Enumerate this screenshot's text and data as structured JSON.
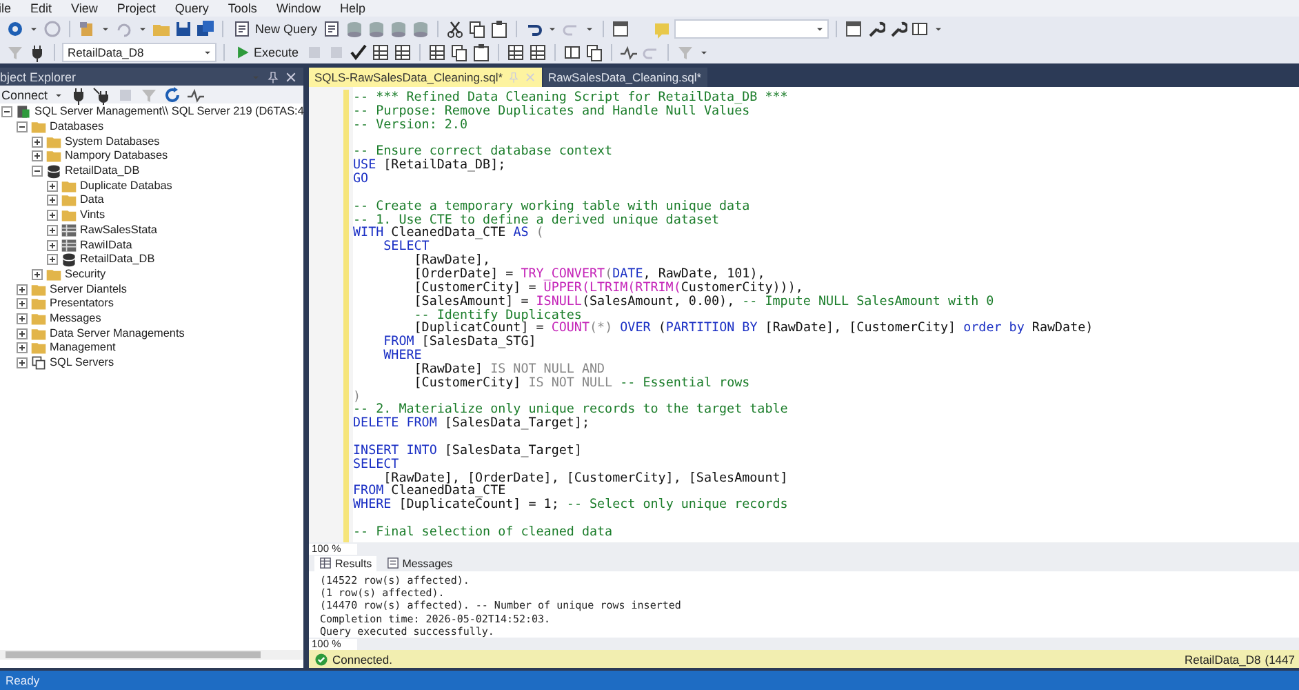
{
  "menu": [
    "ile",
    "Edit",
    "View",
    "Project",
    "Query",
    "Tools",
    "Window",
    "Help"
  ],
  "toolbar": {
    "new_query": "New Query",
    "database": "RetailData_D8",
    "execute": "Execute"
  },
  "explorer": {
    "title": "bject Explorer",
    "connect": "Connect",
    "tree": [
      {
        "label": "SQL Server Management\\\\ SQL Server 219 (D6TAS:4",
        "kind": "server",
        "expanded": true,
        "children": [
          {
            "label": "Databases",
            "kind": "folder",
            "expanded": true,
            "children": [
              {
                "label": "System Databases",
                "kind": "folder",
                "expanded": false
              },
              {
                "label": "Nampory Databases",
                "kind": "folder",
                "expanded": false
              },
              {
                "label": "RetailData_DB",
                "kind": "database",
                "expanded": true,
                "children": [
                  {
                    "label": "Duplicate Databas",
                    "kind": "folder",
                    "expanded": false
                  },
                  {
                    "label": "Data",
                    "kind": "folder",
                    "expanded": false
                  },
                  {
                    "label": "Vints",
                    "kind": "folder",
                    "expanded": false
                  },
                  {
                    "label": "RawSalesStata",
                    "kind": "table",
                    "expanded": false
                  },
                  {
                    "label": "RawiIData",
                    "kind": "table",
                    "expanded": false
                  },
                  {
                    "label": "RetailData_DB",
                    "kind": "database",
                    "expanded": false
                  }
                ]
              },
              {
                "label": "Security",
                "kind": "folder",
                "expanded": false
              }
            ]
          },
          {
            "label": "Server Diantels",
            "kind": "folder",
            "expanded": false
          },
          {
            "label": "Presentators",
            "kind": "folder",
            "expanded": false
          },
          {
            "label": "Messages",
            "kind": "folder",
            "expanded": false
          },
          {
            "label": "Data Server Managements",
            "kind": "folder",
            "expanded": false
          },
          {
            "label": "Management",
            "kind": "folder",
            "expanded": false
          },
          {
            "label": "SQL Servers",
            "kind": "servers",
            "expanded": false
          }
        ]
      }
    ]
  },
  "editor": {
    "tabs": [
      {
        "label": "SQLS-RawSalesData_Cleaning.sql*",
        "selected": true
      },
      {
        "label": "RawSalesData_Cleaning.sql*",
        "selected": false
      }
    ],
    "lines": [
      {
        "kind": "code",
        "tokens": [
          {
            "kind": "comment",
            "text": "-- *** Refined Data Cleaning Script for RetailData_DB ***"
          }
        ]
      },
      {
        "kind": "code",
        "tokens": [
          {
            "kind": "comment",
            "text": "-- Purpose: Remove Duplicates and Handle Null Values"
          }
        ]
      },
      {
        "kind": "code",
        "tokens": [
          {
            "kind": "comment",
            "text": "-- Version: 2.0"
          }
        ]
      },
      {
        "kind": "blank"
      },
      {
        "kind": "code",
        "tokens": [
          {
            "kind": "comment",
            "text": "-- Ensure correct database context"
          }
        ]
      },
      {
        "kind": "code",
        "tokens": [
          {
            "kind": "keyword",
            "text": "USE"
          },
          {
            "kind": "text",
            "text": " [RetailData_DB];"
          }
        ]
      },
      {
        "kind": "code",
        "tokens": [
          {
            "kind": "keyword",
            "text": "GO"
          }
        ]
      },
      {
        "kind": "blank"
      },
      {
        "kind": "code",
        "tokens": [
          {
            "kind": "comment",
            "text": "-- Create a temporary working table with unique data"
          }
        ]
      },
      {
        "kind": "code",
        "tokens": [
          {
            "kind": "comment",
            "text": "-- 1. Use CTE to define a derived unique dataset"
          }
        ]
      },
      {
        "kind": "code",
        "tokens": [
          {
            "kind": "keyword",
            "text": "WITH"
          },
          {
            "kind": "text",
            "text": " CleanedData_CTE "
          },
          {
            "kind": "keyword",
            "text": "AS"
          },
          {
            "kind": "gray",
            "text": " ("
          }
        ]
      },
      {
        "kind": "code",
        "tokens": [
          {
            "kind": "keyword",
            "text": "    SELECT"
          }
        ]
      },
      {
        "kind": "code",
        "tokens": [
          {
            "kind": "text",
            "text": "        [RawDate],"
          }
        ]
      },
      {
        "kind": "code",
        "tokens": [
          {
            "kind": "text",
            "text": "        [OrderDate] = "
          },
          {
            "kind": "function",
            "text": "TRY_CONVERT"
          },
          {
            "kind": "gray",
            "text": "("
          },
          {
            "kind": "keyword",
            "text": "DATE"
          },
          {
            "kind": "text",
            "text": ", RawDate, 101),"
          }
        ]
      },
      {
        "kind": "code",
        "tokens": [
          {
            "kind": "text",
            "text": "        [CustomerCity] = "
          },
          {
            "kind": "function",
            "text": "UPPER(LTRIM(RTRIM("
          },
          {
            "kind": "text",
            "text": "CustomerCity))),"
          }
        ]
      },
      {
        "kind": "code",
        "tokens": [
          {
            "kind": "text",
            "text": "        [SalesAmount] = "
          },
          {
            "kind": "function",
            "text": "ISNULL"
          },
          {
            "kind": "text",
            "text": "(SalesAmount, 0.00), "
          },
          {
            "kind": "comment",
            "text": "-- Impute NULL SalesAmount with 0"
          }
        ]
      },
      {
        "kind": "code",
        "tokens": [
          {
            "kind": "comment",
            "text": "        -- Identify Duplicates"
          }
        ]
      },
      {
        "kind": "code",
        "tokens": [
          {
            "kind": "text",
            "text": "        [DuplicatCount] = "
          },
          {
            "kind": "function",
            "text": "COUNT"
          },
          {
            "kind": "gray",
            "text": "(*) "
          },
          {
            "kind": "keyword",
            "text": "OVER"
          },
          {
            "kind": "text",
            "text": " ("
          },
          {
            "kind": "keyword",
            "text": "PARTITION BY"
          },
          {
            "kind": "text",
            "text": " [RawDate], [CustomerCity] "
          },
          {
            "kind": "keyword",
            "text": "order by"
          },
          {
            "kind": "text",
            "text": " RawDate)"
          }
        ]
      },
      {
        "kind": "code",
        "tokens": [
          {
            "kind": "keyword",
            "text": "    FROM"
          },
          {
            "kind": "text",
            "text": " [SalesData_STG]"
          }
        ]
      },
      {
        "kind": "code",
        "tokens": [
          {
            "kind": "keyword",
            "text": "    WHERE"
          }
        ]
      },
      {
        "kind": "code",
        "tokens": [
          {
            "kind": "text",
            "text": "        [RawDate] "
          },
          {
            "kind": "gray",
            "text": "IS NOT NULL AND"
          }
        ]
      },
      {
        "kind": "code",
        "tokens": [
          {
            "kind": "text",
            "text": "        [CustomerCity] "
          },
          {
            "kind": "gray",
            "text": "IS NOT NULL"
          },
          {
            "kind": "comment",
            "text": " -- Essential rows"
          }
        ]
      },
      {
        "kind": "code",
        "tokens": [
          {
            "kind": "gray",
            "text": ")"
          }
        ]
      },
      {
        "kind": "code",
        "tokens": [
          {
            "kind": "comment",
            "text": "-- 2. Materialize only unique records to the target table"
          }
        ]
      },
      {
        "kind": "code",
        "tokens": [
          {
            "kind": "keyword",
            "text": "DELETE FROM"
          },
          {
            "kind": "text",
            "text": " [SalesData_Target];"
          }
        ]
      },
      {
        "kind": "blank"
      },
      {
        "kind": "code",
        "tokens": [
          {
            "kind": "keyword",
            "text": "INSERT INTO"
          },
          {
            "kind": "text",
            "text": " [SalesData_Target]"
          }
        ]
      },
      {
        "kind": "code",
        "tokens": [
          {
            "kind": "keyword",
            "text": "SELECT"
          }
        ]
      },
      {
        "kind": "code",
        "tokens": [
          {
            "kind": "text",
            "text": "    [RawDate], [OrderDate], [CustomerCity], [SalesAmount]"
          }
        ]
      },
      {
        "kind": "code",
        "tokens": [
          {
            "kind": "keyword",
            "text": "FROM"
          },
          {
            "kind": "text",
            "text": " CleanedData_CTE"
          }
        ]
      },
      {
        "kind": "code",
        "tokens": [
          {
            "kind": "keyword",
            "text": "WHERE"
          },
          {
            "kind": "text",
            "text": " [DuplicateCount] = 1; "
          },
          {
            "kind": "comment",
            "text": "-- Select only unique records"
          }
        ]
      },
      {
        "kind": "blank"
      },
      {
        "kind": "code",
        "tokens": [
          {
            "kind": "comment",
            "text": "-- Final selection of cleaned data"
          }
        ]
      }
    ],
    "zoom": "100 %"
  },
  "results": {
    "tabs": [
      {
        "label": "Results",
        "selected": true
      },
      {
        "label": "Messages",
        "selected": false
      }
    ],
    "messages": [
      "(14522 row(s) affected).",
      "(1 row(s) affected).",
      "(14470 row(s) affected). -- Number of unique rows inserted",
      "Completion time: 2026-05-02T14:52:03.",
      "Query executed successfully."
    ],
    "zoom": "100 %"
  },
  "connection": {
    "status": "Connected.",
    "database": "RetailData_D8",
    "rows": "(1447"
  },
  "status_bar": "Ready"
}
